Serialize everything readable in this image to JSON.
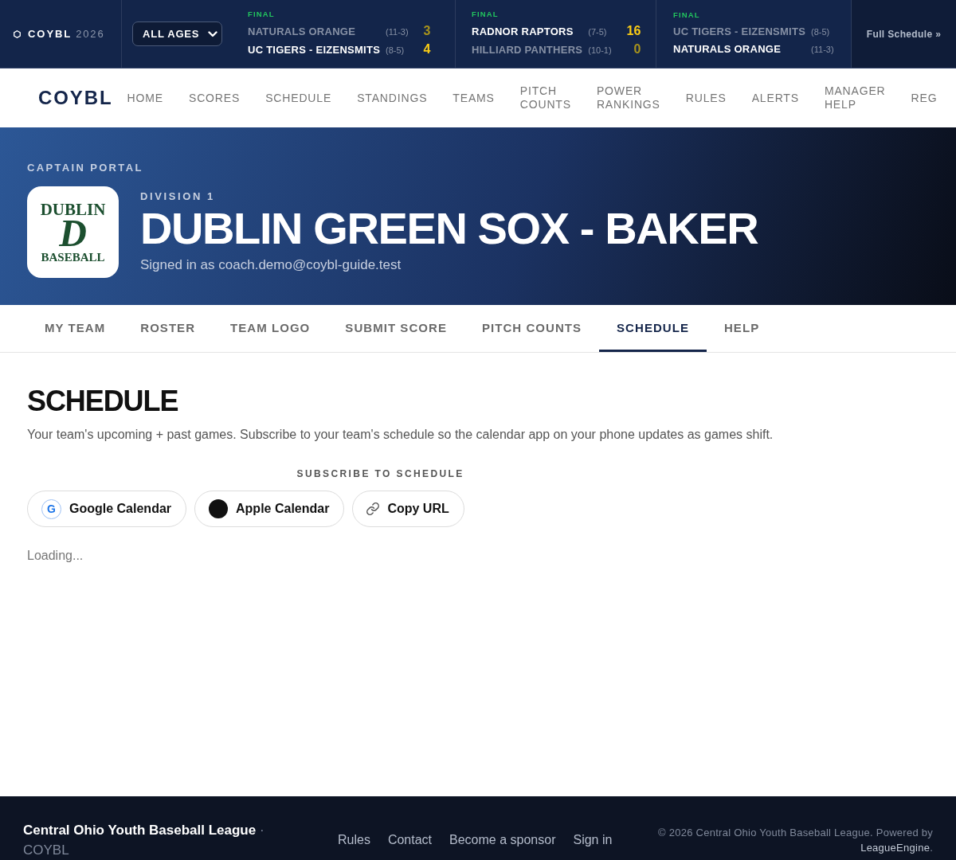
{
  "scoreboard": {
    "brand": "COYBL",
    "season": "2026",
    "age_filter": {
      "value": "ALL AGES"
    },
    "games": [
      {
        "status": "FINAL",
        "teams": [
          {
            "name": "NATURALS ORANGE",
            "record": "(11-3)",
            "score": "3",
            "winner": false
          },
          {
            "name": "UC TIGERS - EIZENSMITS",
            "record": "(8-5)",
            "score": "4",
            "winner": true
          }
        ]
      },
      {
        "status": "FINAL",
        "teams": [
          {
            "name": "RADNOR RAPTORS",
            "record": "(7-5)",
            "score": "16",
            "winner": true
          },
          {
            "name": "HILLIARD PANTHERS",
            "record": "(10-1)",
            "score": "0",
            "winner": false
          }
        ]
      },
      {
        "status": "FINAL",
        "teams": [
          {
            "name": "UC TIGERS - EIZENSMITS",
            "record": "(8-5)",
            "winner": false
          },
          {
            "name": "NATURALS ORANGE",
            "record": "(11-3)",
            "winner": true
          }
        ]
      }
    ],
    "full_schedule_link": "Full Schedule »"
  },
  "nav": {
    "logo": "COYBL",
    "items": [
      {
        "label": "HOME"
      },
      {
        "label": "SCORES"
      },
      {
        "label": "SCHEDULE"
      },
      {
        "label": "STANDINGS"
      },
      {
        "label": "TEAMS"
      },
      {
        "label": "PITCH COUNTS"
      },
      {
        "label": "POWER RANKINGS"
      },
      {
        "label": "RULES"
      },
      {
        "label": "ALERTS"
      },
      {
        "label": "MANAGER HELP"
      },
      {
        "label": "REG"
      }
    ]
  },
  "hero": {
    "eyebrow": "CAPTAIN PORTAL",
    "team_logo": {
      "top_text": "DUBLIN",
      "monogram": "D",
      "bottom_text": "BASEBALL"
    },
    "division": "DIVISION 1",
    "team_name": "DUBLIN GREEN SOX - BAKER",
    "signed_in": "Signed in as coach.demo@coybl-guide.test"
  },
  "tabs": [
    {
      "label": "MY TEAM",
      "selected": false
    },
    {
      "label": "ROSTER",
      "selected": false
    },
    {
      "label": "TEAM LOGO",
      "selected": false
    },
    {
      "label": "SUBMIT SCORE",
      "selected": false
    },
    {
      "label": "PITCH COUNTS",
      "selected": false
    },
    {
      "label": "SCHEDULE",
      "selected": true
    },
    {
      "label": "HELP",
      "selected": false
    }
  ],
  "schedule": {
    "title": "SCHEDULE",
    "description": "Your team's upcoming + past games. Subscribe to your team's schedule so the calendar app on your phone updates as games shift.",
    "subscribe_label": "SUBSCRIBE TO SCHEDULE",
    "subscribe_buttons": [
      {
        "kind": "google",
        "icon_letter": "G",
        "label": "Google Calendar"
      },
      {
        "kind": "apple",
        "label": "Apple Calendar"
      },
      {
        "kind": "link",
        "label": "Copy URL"
      }
    ],
    "loading": "Loading..."
  },
  "footer": {
    "league_name": "Central Ohio Youth Baseball League",
    "separator": "·",
    "abbreviation": "COYBL",
    "links": [
      "Rules",
      "Contact",
      "Become a sponsor",
      "Sign in"
    ],
    "copyright": "© 2026 Central Ohio Youth Baseball League. Powered by",
    "powered_by": "LeagueEngine",
    "copyright_end": "."
  }
}
